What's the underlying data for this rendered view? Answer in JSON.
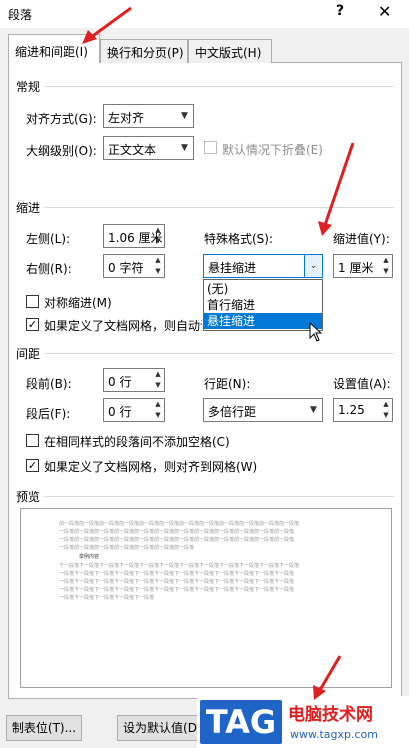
{
  "dialog": {
    "title": "段落",
    "help": "?",
    "close": "✕"
  },
  "tabs": [
    {
      "label": "缩进和间距(I)"
    },
    {
      "label": "换行和分页(P)"
    },
    {
      "label": "中文版式(H)"
    }
  ],
  "general": {
    "heading": "常规",
    "alignment_label": "对齐方式(G):",
    "alignment_value": "左对齐",
    "outline_label": "大纲级别(O):",
    "outline_value": "正文文本",
    "collapse_label": "默认情况下折叠(E)"
  },
  "indent": {
    "heading": "缩进",
    "left_label": "左侧(L):",
    "left_value": "1.06 厘米",
    "right_label": "右侧(R):",
    "right_value": "0 字符",
    "special_label": "特殊格式(S):",
    "special_value": "悬挂缩进",
    "special_options": [
      "(无)",
      "首行缩进",
      "悬挂缩进"
    ],
    "by_label": "缩进值(Y):",
    "by_value": "1 厘米",
    "mirror_label": "对称缩进(M)",
    "grid_label": "如果定义了文档网格，则自动调"
  },
  "spacing": {
    "heading": "间距",
    "before_label": "段前(B):",
    "before_value": "0 行",
    "after_label": "段后(F):",
    "after_value": "0 行",
    "line_label": "行距(N):",
    "line_value": "多倍行距",
    "at_label": "设置值(A):",
    "at_value": "1.25",
    "nospace_label": "在相同样式的段落间不添加空格(C)",
    "snap_label": "如果定义了文档网格，则对齐到网格(W)"
  },
  "preview": {
    "heading": "预览",
    "prev_lines": [
      "前一段落前一段落前一段落前一段落前一段落前一段落前一段落前一段落前一段落前一段落前一段落前一段落",
      "一段落前一段落前一段落前一段落前一段落前一段落前一段落前一段落前一段落前一段落前一段落前一段落",
      "一段落前一段落前一段落前一段落前一段落前一段落前一段落前一段落前一段落前一段落前一段落前一段落",
      "一段落前一段落前一段落前一段落前一段落前一段落前一段落"
    ],
    "sample_line": "举例内容",
    "next_lines": [
      "下一段落下一段落下一段落下一段落下一段落下一段落下一段落下一段落下一段落下一段落下一段落下一段落",
      "一段落下一段落下一段落下一段落下一段落下一段落下一段落下一段落下一段落下一段落下一段落下一段落",
      "一段落下一段落下一段落下一段落下一段落下一段落下一段落下一段落下一段落下一段落下一段落下一段落",
      "一段落下一段落下一段落下一段落下一段落下一段落下一段落下一段落下一段落下一段落下一段落下一段落",
      "一段落下一段落下一段落下一段落下一段落"
    ]
  },
  "buttons": {
    "tabs": "制表位(T)...",
    "default": "设为默认值(D"
  },
  "watermark": {
    "badge": "TAG",
    "title": "电脑技术网",
    "url": "www.tagxp.com"
  },
  "colors": {
    "accent": "#0078d7",
    "arrow": "#e02020",
    "brand": "#1f64c7"
  }
}
